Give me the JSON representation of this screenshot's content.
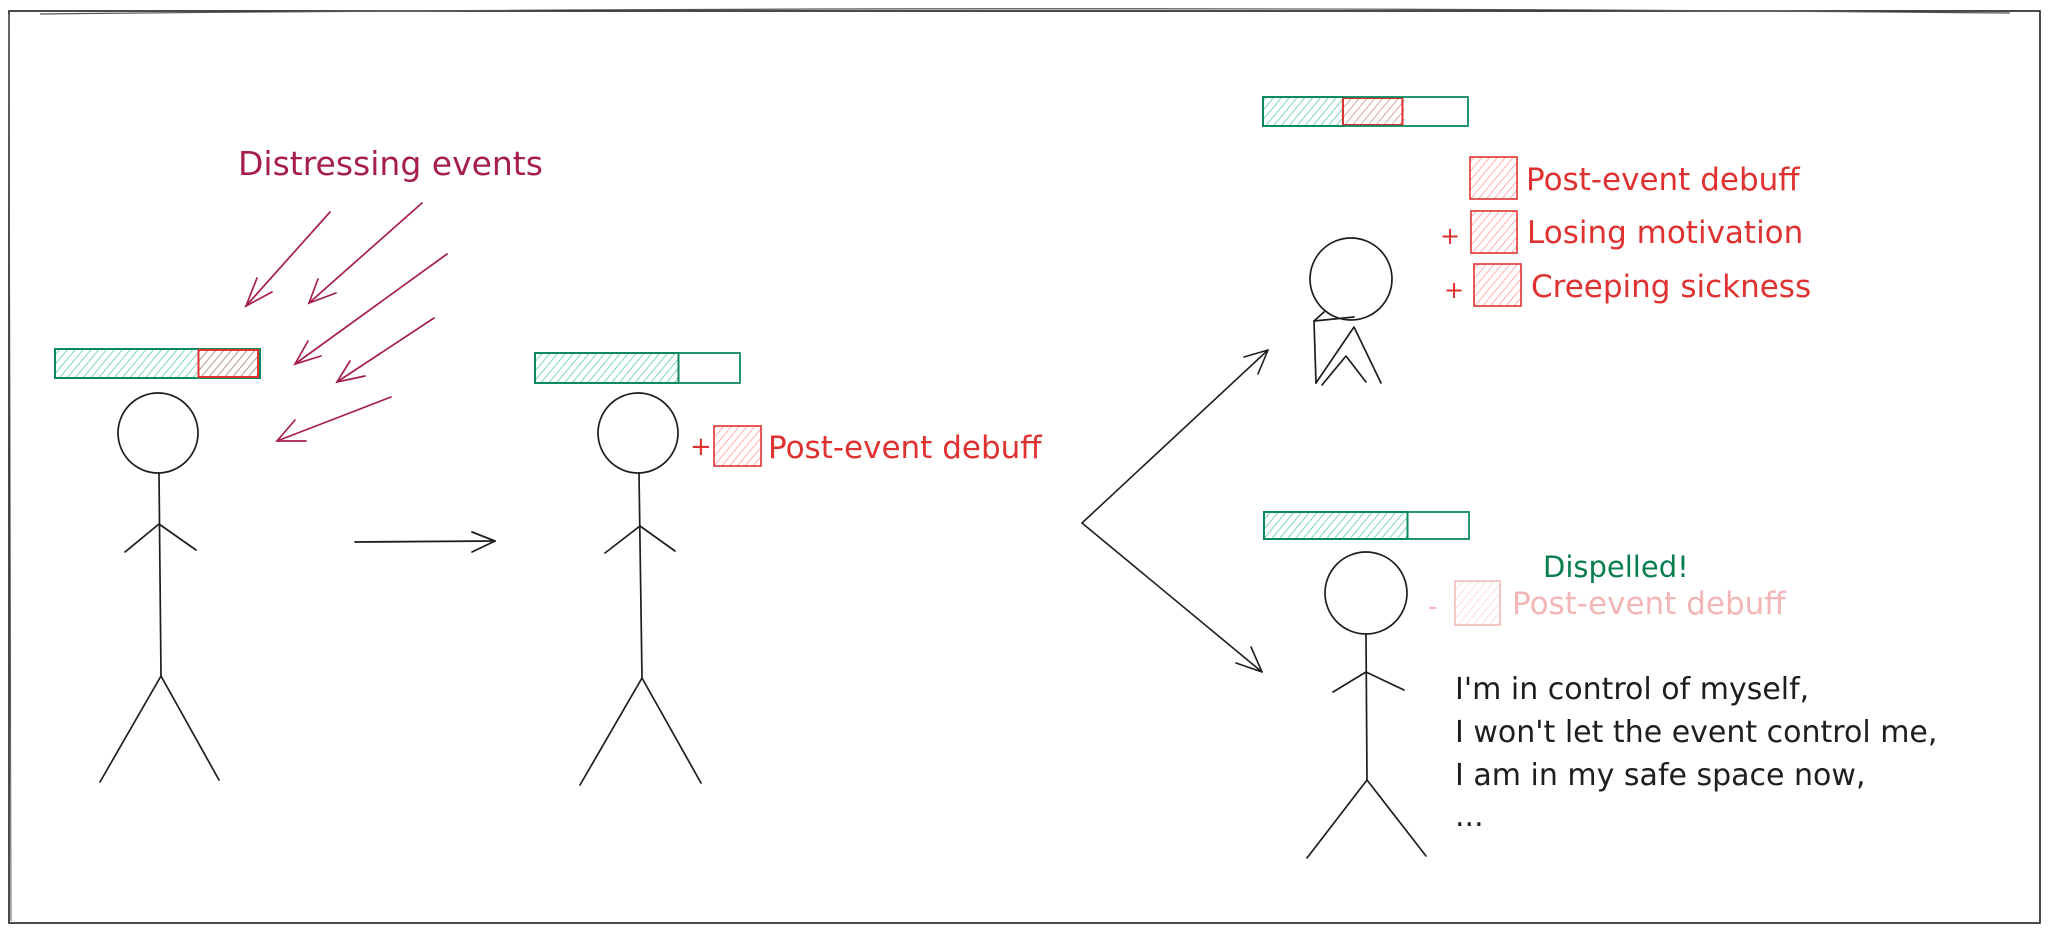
{
  "colors": {
    "ink": "#1e1e1e",
    "health_stroke": "#0c8a5f",
    "health_fill": "#63c9a4",
    "debuff_stroke": "#e03131",
    "debuff_fill": "#ffa8a8",
    "debuff_faded": "#f3b6b6",
    "events": "#a61e4d",
    "dispelled": "#0a7d4f"
  },
  "scene1": {
    "label": "Distressing events",
    "health_bar": {
      "health_fraction": 0.7,
      "damage_fraction": 0.3
    }
  },
  "scene2": {
    "health_bar": {
      "health_fraction": 0.7,
      "damage_fraction": 0
    },
    "buff": {
      "sign": "+",
      "label": "Post-event debuff"
    }
  },
  "scene3_worse": {
    "health_bar": {
      "health_fraction": 0.39,
      "damage_fraction": 0.3
    },
    "buffs": [
      {
        "sign": "",
        "label": "Post-event debuff"
      },
      {
        "sign": "+",
        "label": "Losing motivation"
      },
      {
        "sign": "+",
        "label": "Creeping sickness"
      }
    ]
  },
  "scene3_better": {
    "health_bar": {
      "health_fraction": 0.7,
      "damage_fraction": 0
    },
    "status": "Dispelled!",
    "removed_buff": {
      "sign": "-",
      "label": "Post-event debuff"
    },
    "affirmations": [
      "I'm in control of myself,",
      "I won't let the event control me,",
      "I am in my safe space now,",
      "..."
    ]
  }
}
